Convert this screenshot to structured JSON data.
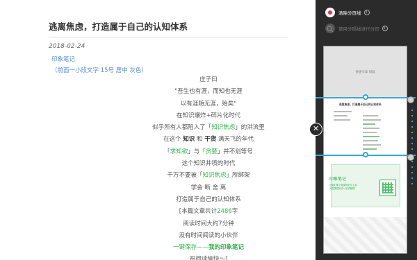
{
  "article": {
    "title": "逃离焦虑，打造属于自己的认知体系",
    "date": "2018-02-24",
    "source": "印象笔记",
    "note": "（前面一小段文字  15号  居中  灰色）",
    "lines": {
      "l1": "庄子曰",
      "l2": "\"吾生也有涯，而知也无涯",
      "l3": "以有涯随无涯，殆矣\"",
      "l4": "在知识爆炸+碎片化时代",
      "l5a": "似乎所有人都陷入了「",
      "l5b": "知识焦虑",
      "l5c": "」的洪流里",
      "l6a": "在这个",
      "l6b": "知识",
      "l6c": "和",
      "l6d": "干货",
      "l6e": "满天飞的年代",
      "l7a": "「",
      "l7b": "求知欲",
      "l7c": "」与「",
      "l7d": "贪婪",
      "l7e": "」并不划等号",
      "l8": "这个知识井喷的时代",
      "l9a": "千万不要被「",
      "l9b": "知识焦虑",
      "l9c": "」所绑架",
      "l10": "学会 断 舍 离",
      "l11": "打造属于自己的认知体系",
      "l12a": "[本篇文章共计",
      "l12b": "2486",
      "l12c": "字",
      "l13": "阅读时间大约7分钟",
      "l14": "没有时间阅读的小伙伴",
      "l15a": "一键保存——",
      "l15b": "我的印象笔记",
      "l16": "祝阅读愉快～]"
    }
  },
  "close_button": {
    "glyph": "✕"
  },
  "panel": {
    "option1_label": "清除分页线",
    "option2_label": "使用分隔线进行分页",
    "info_glyph": "i",
    "preview": {
      "top_text": "快捷文章 排版",
      "mid_title": "逃离焦虑，打造属于自己的认知体系",
      "bottom_title": "印象笔记",
      "bottom_text": "这里汇集了各类知识与工具\n为您提供知识一站式管理",
      "icons": {
        "qr": "qr-code-icon"
      }
    }
  },
  "colors": {
    "accent_green": "#2fb44a",
    "split_blue": "#35a6dc",
    "panel_bg": "#2b2b2b",
    "record_red": "#e8334a"
  }
}
